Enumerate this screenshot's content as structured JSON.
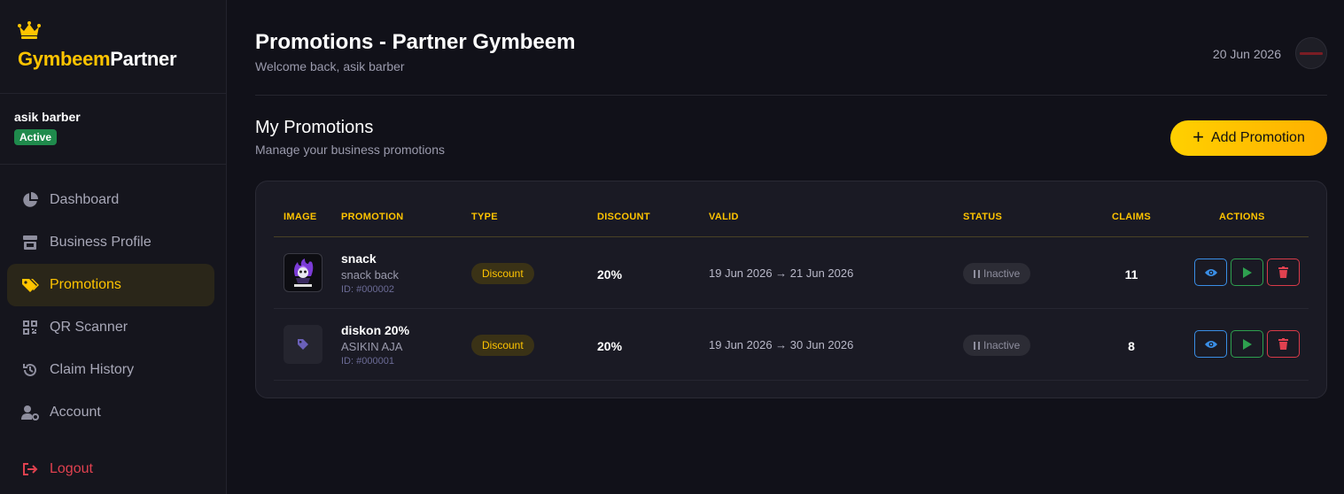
{
  "brand": {
    "name_part1": "Gymbeem",
    "name_part2": "Partner",
    "icon": "crown-icon"
  },
  "user": {
    "name": "asik barber",
    "status": "Active"
  },
  "nav": [
    {
      "label": "Dashboard",
      "icon": "pie-chart-icon"
    },
    {
      "label": "Business Profile",
      "icon": "store-icon"
    },
    {
      "label": "Promotions",
      "icon": "tags-icon",
      "active": true
    },
    {
      "label": "QR Scanner",
      "icon": "qr-code-icon"
    },
    {
      "label": "Claim History",
      "icon": "history-icon"
    },
    {
      "label": "Account",
      "icon": "user-gear-icon"
    }
  ],
  "logout_label": "Logout",
  "header": {
    "title": "Promotions - Partner Gymbeem",
    "subtitle": "Welcome back, asik barber",
    "date": "20 Jun 2026"
  },
  "section": {
    "title": "My Promotions",
    "subtitle": "Manage your business promotions",
    "add_button": "Add Promotion"
  },
  "table": {
    "columns": [
      "IMAGE",
      "PROMOTION",
      "TYPE",
      "DISCOUNT",
      "VALID",
      "STATUS",
      "CLAIMS",
      "ACTIONS"
    ],
    "rows": [
      {
        "title": "snack",
        "description": "snack back",
        "id": "ID: #000002",
        "type": "Discount",
        "discount": "20%",
        "valid": "19 Jun 2026 → 21 Jun 2026",
        "status": "Inactive",
        "claims": "11",
        "image": "custom"
      },
      {
        "title": "diskon 20%",
        "description": "ASIKIN AJA",
        "id": "ID: #000001",
        "type": "Discount",
        "discount": "20%",
        "valid": "19 Jun 2026 → 30 Jun 2026",
        "status": "Inactive",
        "claims": "8",
        "image": "placeholder-tag"
      }
    ]
  },
  "colors": {
    "accent": "#ffc400",
    "active_green": "#1f8a4c",
    "danger": "#e0414f",
    "info": "#3a8ee6",
    "success": "#2ea04f"
  }
}
